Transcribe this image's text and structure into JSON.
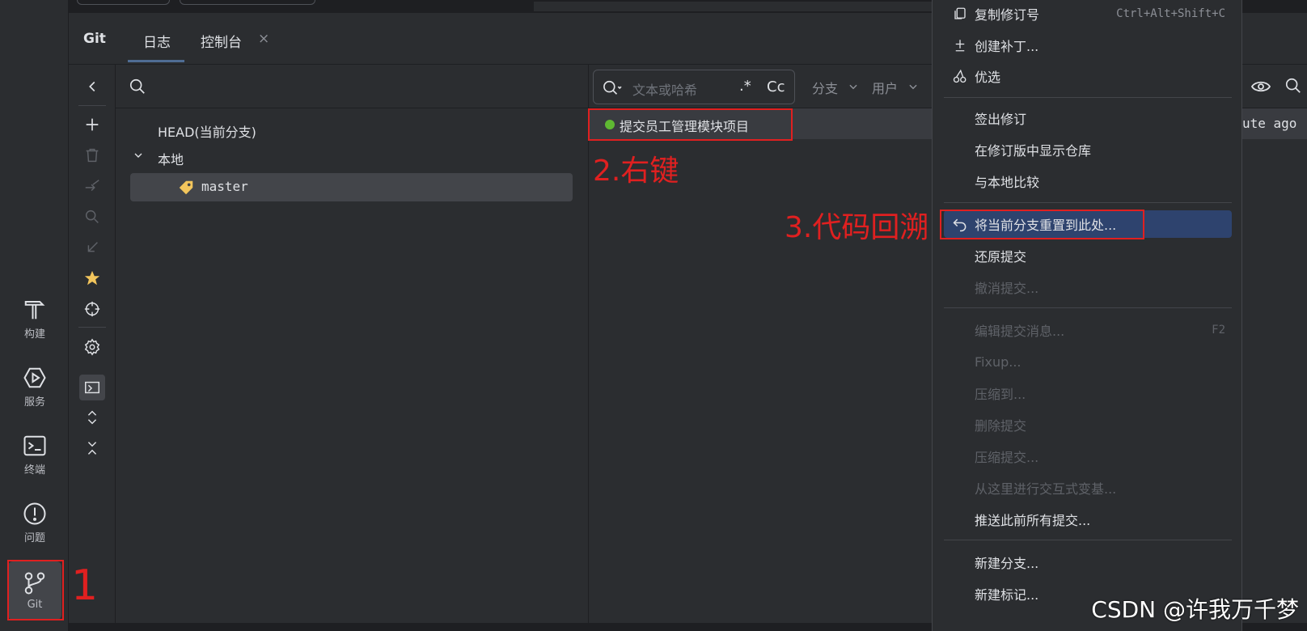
{
  "tool_strip": {
    "items": [
      {
        "label": "构建",
        "icon": "hammer-icon"
      },
      {
        "label": "服务",
        "icon": "services-icon"
      },
      {
        "label": "终端",
        "icon": "terminal-icon"
      },
      {
        "label": "问题",
        "icon": "problems-icon"
      },
      {
        "label": "Git",
        "icon": "git-branch-icon"
      }
    ]
  },
  "tabs": {
    "git": "Git",
    "log": "日志",
    "console": "控制台",
    "close": "×"
  },
  "branches": {
    "head": "HEAD(当前分支)",
    "local": "本地",
    "master": "master"
  },
  "log": {
    "search_placeholder": "文本或哈希",
    "regex": ".*",
    "case": "Cc",
    "branch_filter": "分支",
    "user_filter": "用户",
    "commit_message": "提交员工管理模块项目",
    "commit_time": "ute ago"
  },
  "annotations": {
    "step1": "1",
    "step2": "2.右键",
    "step3": "3.代码回溯"
  },
  "context_menu": {
    "copy_revision": {
      "label": "复制修订号",
      "shortcut": "Ctrl+Alt+Shift+C"
    },
    "create_patch": "创建补丁...",
    "cherry_pick": "优选",
    "checkout_revision": "签出修订",
    "show_repo_at_revision": "在修订版中显示仓库",
    "compare_with_local": "与本地比较",
    "reset_branch": "将当前分支重置到此处...",
    "revert_commit": "还原提交",
    "undo_commit": "撤消提交...",
    "edit_message": {
      "label": "编辑提交消息...",
      "shortcut": "F2"
    },
    "fixup": "Fixup...",
    "squash_into": "压缩到...",
    "drop_commit": "删除提交",
    "squash_commits": "压缩提交...",
    "interactive_rebase": "从这里进行交互式变基...",
    "push_all_up_to_here": "推送此前所有提交...",
    "new_branch": "新建分支...",
    "new_tag": "新建标记..."
  },
  "watermark": "CSDN @许我万千梦",
  "colors": {
    "annotation_red": "#e02020",
    "selection_blue": "#2e436e",
    "commit_dot": "#5fb832",
    "star": "#f2c55c"
  }
}
